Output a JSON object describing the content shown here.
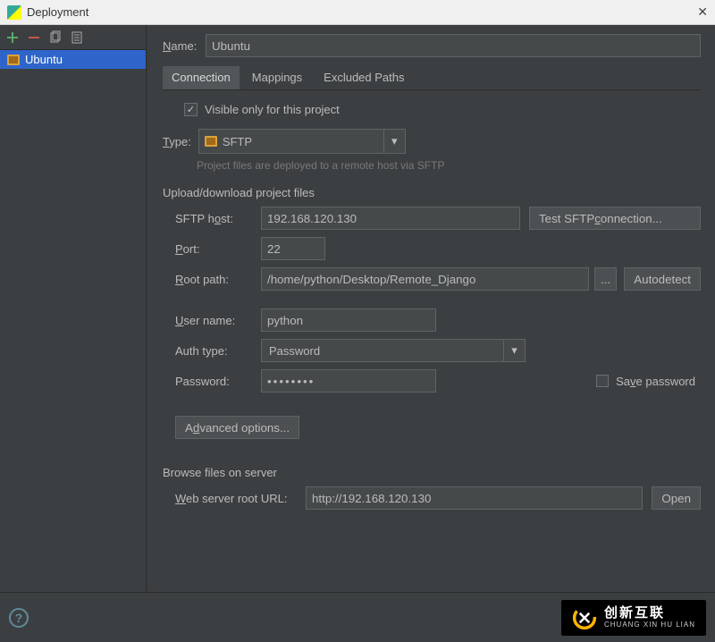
{
  "window": {
    "title": "Deployment"
  },
  "sidebar": {
    "items": [
      {
        "label": "Ubuntu"
      }
    ]
  },
  "name_field": {
    "label": "Name:",
    "value": "Ubuntu"
  },
  "tabs": [
    {
      "label": "Connection",
      "active": true
    },
    {
      "label": "Mappings",
      "active": false
    },
    {
      "label": "Excluded Paths",
      "active": false
    }
  ],
  "visible_only": {
    "label": "Visible only for this project",
    "checked": true
  },
  "type": {
    "label": "Type:",
    "value": "SFTP",
    "hint": "Project files are deployed to a remote host via SFTP"
  },
  "upload_section": {
    "title": "Upload/download project files",
    "host": {
      "label": "SFTP host:",
      "value": "192.168.120.130"
    },
    "test_btn": "Test SFTP connection...",
    "port": {
      "label": "Port:",
      "value": "22"
    },
    "root_path": {
      "label": "Root path:",
      "value": "/home/python/Desktop/Remote_Django"
    },
    "browse_btn": "...",
    "autodetect_btn": "Autodetect",
    "user": {
      "label": "User name:",
      "value": "python"
    },
    "auth_type": {
      "label": "Auth type:",
      "value": "Password"
    },
    "password": {
      "label": "Password:",
      "value": "••••••••"
    },
    "save_password": {
      "label": "Save password",
      "checked": false
    },
    "advanced_btn": "Advanced options..."
  },
  "browse_section": {
    "title": "Browse files on server",
    "web_url": {
      "label": "Web server root URL:",
      "value": "http://192.168.120.130"
    },
    "open_btn": "Open"
  },
  "brand": {
    "cn": "创新互联",
    "en": "CHUANG XIN HU LIAN"
  }
}
